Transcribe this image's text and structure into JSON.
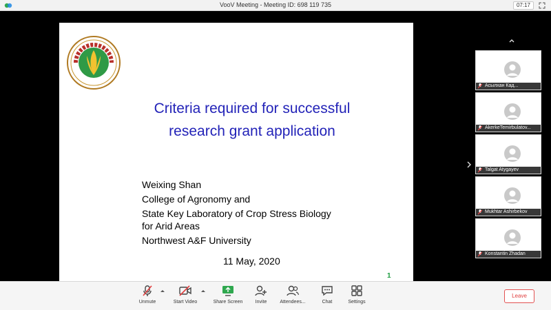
{
  "window": {
    "title": "VooV Meeting - Meeting ID: 698 119 735",
    "timer": "07:17",
    "logo_icon": "voov-logo-icon",
    "expand_icon": "expand-icon"
  },
  "slide": {
    "emblem_text": "NORTHWEST A&F UNIVERSITY",
    "heading_line1": "Criteria required for successful",
    "heading_line2": "research grant application",
    "author_lines": [
      "Weixing Shan",
      "College of Agronomy and",
      "State Key Laboratory of Crop Stress Biology",
      "for Arid Areas",
      "Northwest A&F University"
    ],
    "date": "11 May, 2020",
    "page_number": "1",
    "heading_color": "#2323b8"
  },
  "participants": [
    {
      "name": "Асылхан Кад..."
    },
    {
      "name": "AkerkeTemirbulatov..."
    },
    {
      "name": "Talgat Atygayev"
    },
    {
      "name": "Mukhtar Ashirbekov"
    },
    {
      "name": "Konstantin Zhadan"
    }
  ],
  "toolbar": {
    "unmute": "Unmute",
    "start_video": "Start Video",
    "share_screen": "Share Screen",
    "invite": "Invite",
    "attendees": "Attendees...",
    "chat": "Chat",
    "settings": "Settings",
    "leave": "Leave",
    "leave_color": "#e04040"
  }
}
